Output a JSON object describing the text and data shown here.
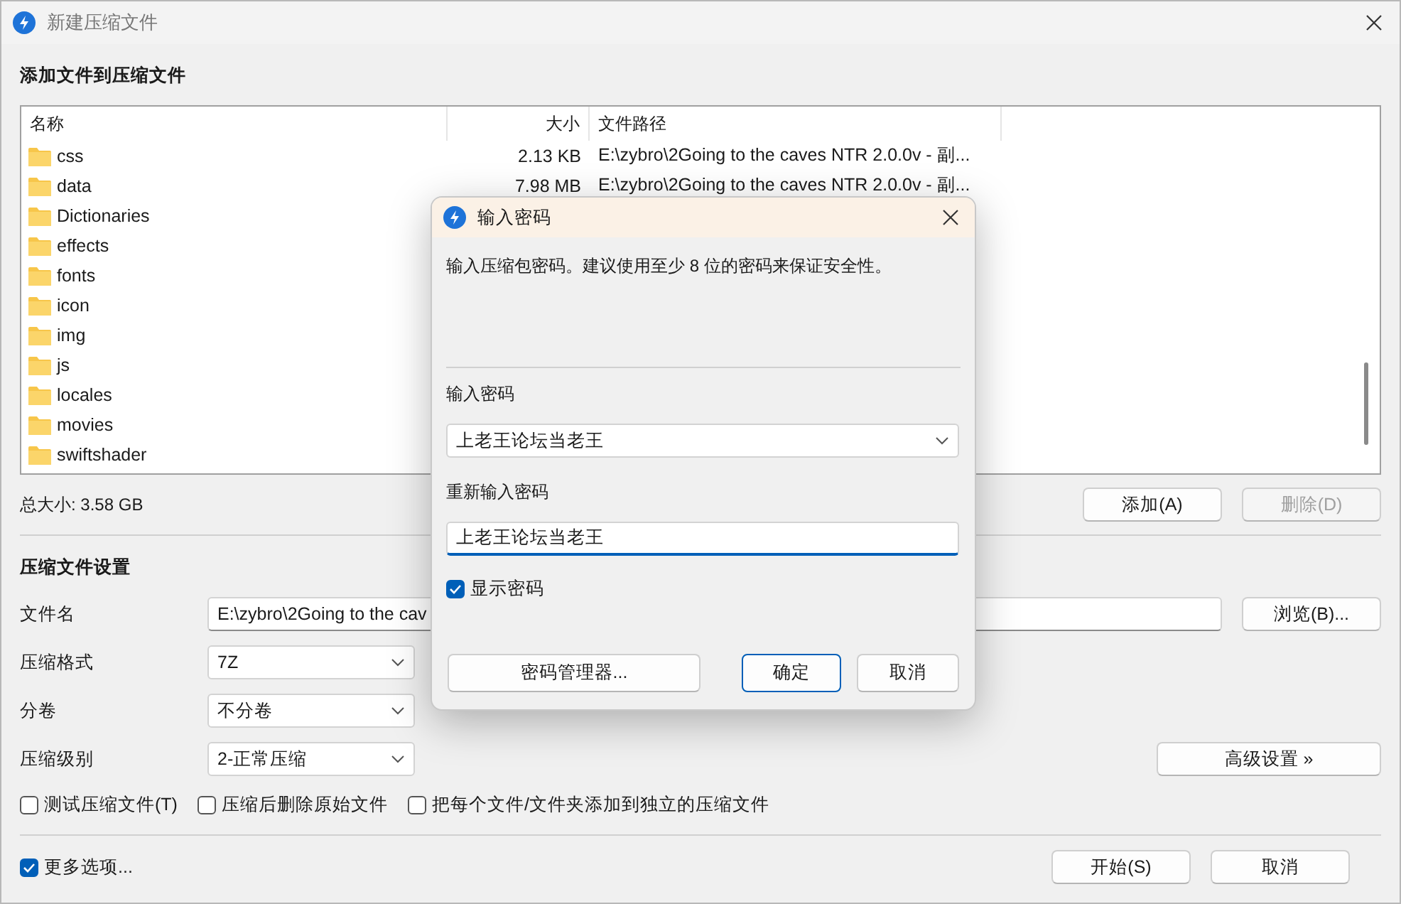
{
  "window": {
    "title": "新建压缩文件"
  },
  "files_section": {
    "heading": "添加文件到压缩文件",
    "columns": [
      "名称",
      "大小",
      "文件路径"
    ],
    "rows": [
      {
        "name": "css",
        "size": "2.13 KB",
        "path": "E:\\zybro\\2Going to the caves NTR 2.0.0v - 副..."
      },
      {
        "name": "data",
        "size": "7.98 MB",
        "path": "E:\\zybro\\2Going to the caves NTR 2.0.0v - 副..."
      },
      {
        "name": "Dictionaries"
      },
      {
        "name": "effects"
      },
      {
        "name": "fonts"
      },
      {
        "name": "icon"
      },
      {
        "name": "img"
      },
      {
        "name": "js"
      },
      {
        "name": "locales"
      },
      {
        "name": "movies"
      },
      {
        "name": "swiftshader"
      }
    ],
    "total": "总大小: 3.58 GB",
    "buttons": [
      {
        "label": "添加(A)",
        "disabled": false
      },
      {
        "label": "删除(D)",
        "disabled": true
      }
    ]
  },
  "settings": {
    "heading": "压缩文件设置",
    "filename": {
      "label": "文件名",
      "value": "E:\\zybro\\2Going to the cav"
    },
    "browse_button": "浏览(B)...",
    "selects": [
      {
        "label": "压缩格式",
        "value": "7Z"
      },
      {
        "label": "分卷",
        "value": "不分卷"
      },
      {
        "label": "压缩级别",
        "value": "2-正常压缩"
      }
    ],
    "advanced_button": "高级设置 »",
    "options": [
      {
        "label": "测试压缩文件(T)",
        "checked": false
      },
      {
        "label": "压缩后删除原始文件",
        "checked": false
      },
      {
        "label": "把每个文件/文件夹添加到独立的压缩文件",
        "checked": false
      }
    ]
  },
  "footer": {
    "more_options": {
      "label": "更多选项...",
      "checked": true
    },
    "buttons": [
      "开始(S)",
      "取消"
    ]
  },
  "password_dialog": {
    "title": "输入密码",
    "message": "输入压缩包密码。建议使用至少 8 位的密码来保证安全性。",
    "password": {
      "label": "输入密码",
      "value": "上老王论坛当老王"
    },
    "confirm": {
      "label": "重新输入密码",
      "value": "上老王论坛当老王"
    },
    "show_password": {
      "label": "显示密码",
      "checked": true
    },
    "buttons": [
      {
        "label": "密码管理器...",
        "default": false
      },
      {
        "label": "确定",
        "default": true
      },
      {
        "label": "取消",
        "default": false
      }
    ]
  }
}
